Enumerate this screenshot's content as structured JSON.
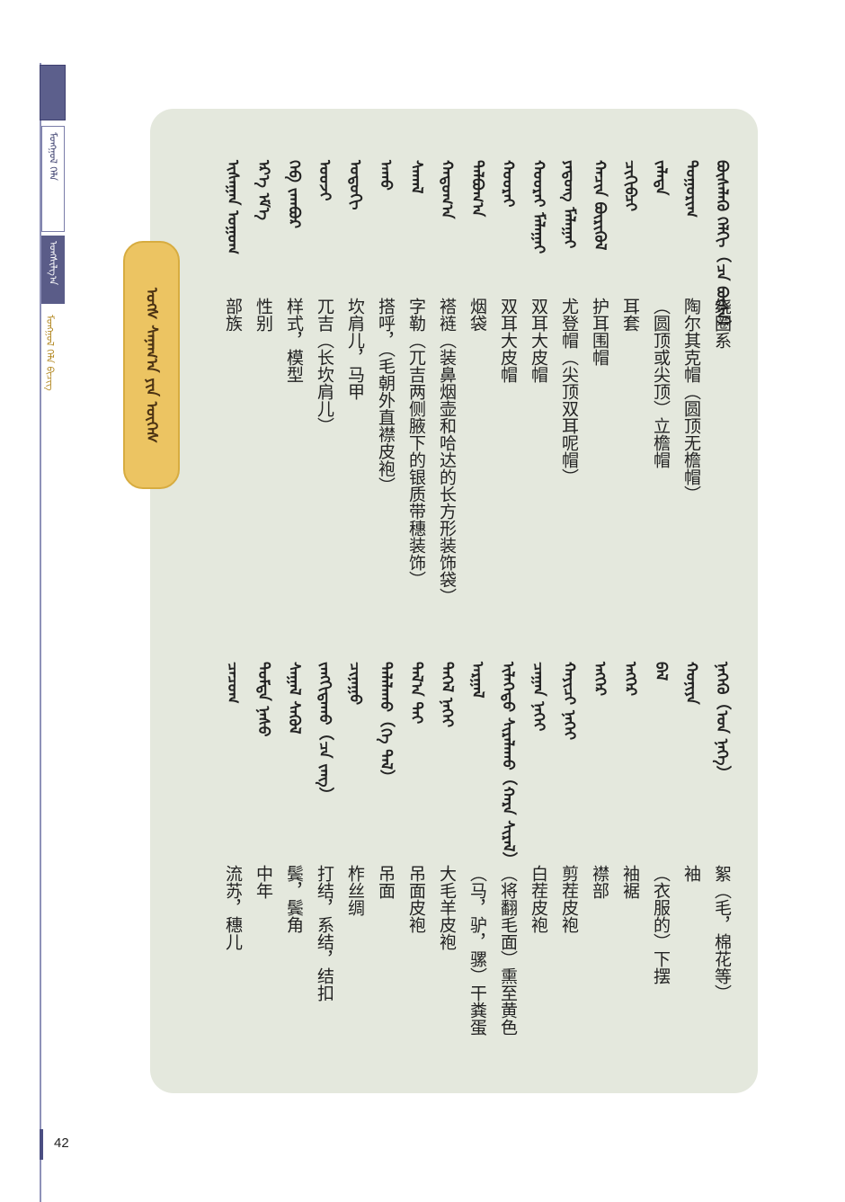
{
  "side": {
    "box1": "ᠮᠣᠩᠭᠣᠯ ᠬᠡᠯᠡ",
    "box2": "ᠤᠩᠱᠢᠯᠭ᠎ᠠ",
    "running_head": "ᠮᠣᠩᠭᠣᠯ ᠬᠡᠯᠡ ᠪᠢᠴᠢᠭ"
  },
  "page_number": "42",
  "section_title": "ᠤᠭ᠌ᠰ ᠰᠠᠨᠠᠭ᠎ᠠ ᠶᠢᠨ ᠦᠭᠡᠰ",
  "vocab_left": [
    {
      "mn": "ᠪᠦᠰᠡᠯᠡᠬᠦ ᠬᠡᠯᠬᠢ（ᠴᠡ ᠪᠦᠰᠡ）",
      "zh": "绕圈系"
    },
    {
      "mn": "ᠲᠣᠭᠣᠷᠢᠭ",
      "zh": "陶尔其克帽（圆顶无檐帽）"
    },
    {
      "mn": "ᠵᠠᠯᠠᠲᠠ",
      "zh": "（圆顶或尖顶）立檐帽"
    },
    {
      "mn": "ᠴᠢᠬᠢᠪᠴᠢ",
      "zh": "耳套"
    },
    {
      "mn": "ᠬᠠᠴᠢᠨ ᠪᠦᠷᠢᠭᠦᠯ",
      "zh": "护耳围帽"
    },
    {
      "mn": "ᠶᠠᠳᠤᠩ ᠮᠠᠯᠠᠭᠠᠢ",
      "zh": "尤登帽（尖顶双耳呢帽）"
    },
    {
      "mn": "ᠬᠣᠣᠷᠠᠢ ᠮᠠᠯᠠᠭᠠᠢ",
      "zh": "双耳大皮帽"
    },
    {
      "mn": "ᠬᠣᠣᠷᠠᠢ",
      "zh": "双耳大皮帽"
    },
    {
      "mn": "ᠳᠠᠯᠪᠤᠭ᠎ᠠ",
      "zh": "烟袋"
    },
    {
      "mn": "ᠬᠠᠲᠤᠭ᠎ᠠ",
      "zh": "褡裢（装鼻烟壶和哈达的长方形装饰袋）"
    },
    {
      "mn": "ᠰᠠᠬᠠᠯ",
      "zh": "字勒（兀吉两侧腋下的银质带穗装饰）"
    },
    {
      "mn": "ᠠᠬᠤ",
      "zh": "搭呼，（毛朝外直襟皮袍）"
    },
    {
      "mn": "ᠣᠳᠣᠬᠢ",
      "zh": "坎肩儿，马甲"
    },
    {
      "mn": "ᠤᠤᠵᠢ",
      "zh": "兀吉（长坎肩儿）"
    },
    {
      "mn": "ᠬᠡᠪ ᠵᠠᠭᠪᠤᠷ",
      "zh": "样式，模型"
    },
    {
      "mn": "ᠡᠷ᠎ᠡ ᠡᠮ᠎ᠡ",
      "zh": "性别"
    },
    {
      "mn": "ᠢᠰᠠᠭᠠᠨ ᠣᠭᠣᠭ",
      "zh": "部族"
    }
  ],
  "vocab_right": [
    {
      "mn": "ᠨᠡᠬᠡᠬᠦ（ᠡᠳ ᠨᠡᠬᠡ）",
      "zh": "絮（毛，棉花等）"
    },
    {
      "mn": "ᠬᠣᠨᠢᠶᠠ",
      "zh": "袖"
    },
    {
      "mn": "ᠪᠡᠯ",
      "zh": "（衣服的）下摆"
    },
    {
      "mn": "ᠡᠩᠭᠡᠷ",
      "zh": "袖裾"
    },
    {
      "mn": "ᠡᠩᠭᠡᠷ",
      "zh": "襟部"
    },
    {
      "mn": "ᠬᠠᠶᠢᠴᠢ ᠨᠡᠬᠡᠢ",
      "zh": "剪茬皮袍"
    },
    {
      "mn": "ᠴᠠᠭᠠᠨ ᠨᠡᠬᠡᠢ",
      "zh": "白茬皮袍"
    },
    {
      "mn": "ᠢᠯᠡᠭᠡᠳᠦ ᠰᠢᠷᠠᠯᠠᠬᠤ（ᠬᠠᠷᠠ ᠰᠢᠷᠠᠯ）",
      "zh": "（将翻毛面）熏至黄色"
    },
    {
      "mn": "ᠠᠷᠭᠠᠯ",
      "zh": "（马，驴，骡）干粪蛋"
    },
    {
      "mn": "ᠳᠡᠭᠡᠯ ᠨᠡᠬᠡᠢ",
      "zh": "大毛羊皮袍"
    },
    {
      "mn": "ᠲᠠᠯ᠎ᠠ ᠲᠠᠢ",
      "zh": "吊面皮袍"
    },
    {
      "mn": "ᠲᠠᠯᠠᠯᠠᠬᠤ（ᠬᠡ ᠲᠠᠯ）",
      "zh": "吊面"
    },
    {
      "mn": "ᠴᠢᠨᠠᠭᠤ",
      "zh": "柞丝绸"
    },
    {
      "mn": "ᠵᠠᠩᠭᠢᠳᠠᠬᠤ（ᠴᠡ ᠵᠠᠩ）",
      "zh": "打结，系结，结扣"
    },
    {
      "mn": "ᠰᠠᠭᠠᠯ ᠰᠡᠭᠦᠯ",
      "zh": "鬓，鬓角"
    },
    {
      "mn": "ᠳᠤᠮᠳᠠ ᠨᠠᠰᠤ",
      "zh": "中年"
    },
    {
      "mn": "ᠴᠠᠴᠤᠭ",
      "zh": "流苏，穗儿"
    }
  ]
}
